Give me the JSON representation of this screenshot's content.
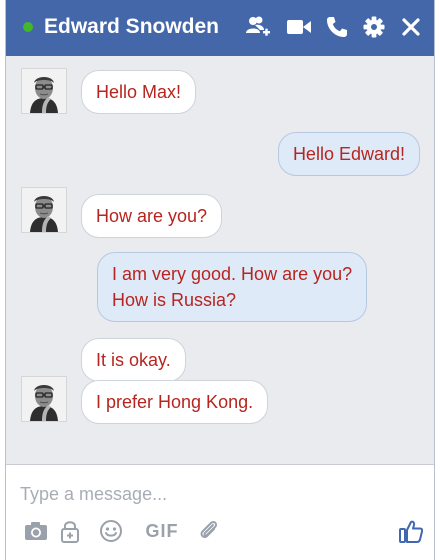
{
  "header": {
    "title": "Edward Snowden",
    "status": "online",
    "status_color": "#42b72a",
    "background_color": "#4467a9",
    "icons": [
      "add-friend-icon",
      "video-call-icon",
      "phone-icon",
      "gear-icon",
      "close-icon"
    ]
  },
  "messages": [
    {
      "sender": "contact",
      "text": "Hello Max!"
    },
    {
      "sender": "self",
      "text": "Hello Edward!"
    },
    {
      "sender": "contact",
      "text": "How are you?"
    },
    {
      "sender": "self",
      "lines": [
        "I am very good. How are you?",
        "How is Russia?"
      ]
    },
    {
      "sender": "contact",
      "text": "It is okay."
    },
    {
      "sender": "contact",
      "text": "I prefer Hong Kong."
    }
  ],
  "composer": {
    "placeholder": "Type a message...",
    "value": "",
    "tools": [
      "camera-icon",
      "lock-icon",
      "emoji-icon",
      "gif-icon",
      "attachment-icon"
    ],
    "gif_label": "GIF",
    "send_icon": "like-icon"
  },
  "colors": {
    "message_text": "#b6251f",
    "incoming_bubble": "#ffffff",
    "outgoing_bubble": "#dfeaf9",
    "conversation_background": "#e9ebee",
    "like_icon": "#4267b2"
  }
}
